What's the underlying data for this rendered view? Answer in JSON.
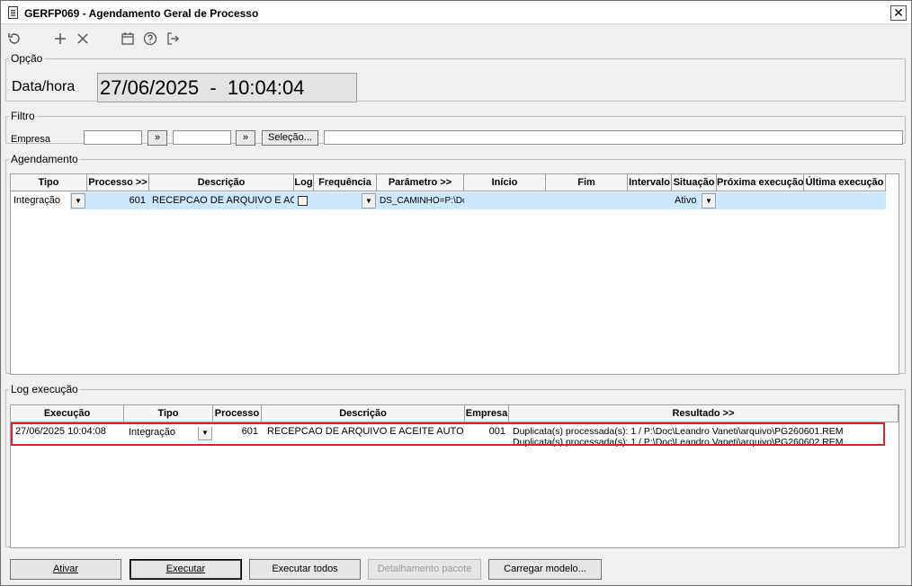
{
  "window": {
    "title": "GERFP069 - Agendamento Geral de Processo",
    "close_glyph": "✕"
  },
  "toolbar": {
    "icons": [
      "refresh-icon",
      "add-icon",
      "delete-icon",
      "calendar-icon",
      "help-icon",
      "exit-icon"
    ]
  },
  "opcao": {
    "legend": "Opção",
    "label": "Data/hora",
    "value": "27/06/2025  -  10:04:04"
  },
  "filtro": {
    "legend": "Filtro",
    "empresa_label": "Empresa",
    "empresa_from": "",
    "empresa_to": "",
    "arrow_label": "»",
    "selecao_label": "Seleção...",
    "selecao_text": ""
  },
  "agendamento": {
    "legend": "Agendamento",
    "columns": [
      "Tipo",
      "Processo >>",
      "Descrição",
      "Log",
      "Frequência",
      "Parâmetro >>",
      "Início",
      "Fim",
      "Intervalo",
      "Situação",
      "Próxima execução",
      "Última execução"
    ],
    "rows": [
      {
        "tipo": "Integração",
        "processo": "601",
        "descricao": "RECEPCAO DE ARQUIVO E ACEITE",
        "log": false,
        "frequencia": "",
        "parametro": "DS_CAMINHO=P:\\Do",
        "inicio": "",
        "fim": "",
        "intervalo": "",
        "situacao": "Ativo",
        "proxima": "",
        "ultima": ""
      }
    ]
  },
  "log": {
    "legend": "Log execução",
    "columns": [
      "Execução",
      "Tipo",
      "Processo",
      "Descrição",
      "Empresa",
      "Resultado >>"
    ],
    "rows": [
      {
        "execucao": "27/06/2025 10:04:08",
        "tipo": "Integração",
        "processo": "601",
        "descricao": "RECEPCAO DE ARQUIVO E ACEITE AUTOMAT",
        "empresa": "001",
        "resultado": "Duplicata(s) processada(s): 1 / P:\\Doc\\Leandro Vaneti\\arquivo\\PG260601.REM",
        "resultado_2": "Duplicata(s) processada(s): 1 / P:\\Doc\\Leandro Vaneti\\arquivo\\PG260602.REM"
      }
    ]
  },
  "buttons": {
    "ativar": "Ativar",
    "executar": "Executar",
    "executar_todos": "Executar todos",
    "detalhamento": "Detalhamento pacote",
    "carregar": "Carregar modelo..."
  },
  "colors": {
    "selected_row": "#cce8ff",
    "highlight_border": "#d8232a",
    "readonly_bg": "#e3e3e3"
  }
}
